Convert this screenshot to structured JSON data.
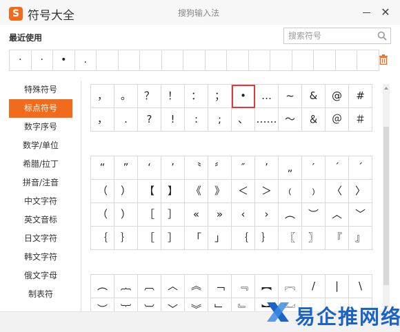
{
  "window": {
    "logo_glyph": "S",
    "title": "符号大全",
    "ime_name": "搜狗输入法",
    "close_glyph": "✕"
  },
  "recent": {
    "label": "最近使用",
    "items": [
      "·",
      "·",
      "•",
      ".",
      "",
      "",
      "",
      "",
      "",
      "",
      "",
      "",
      "",
      "",
      "",
      "",
      ""
    ]
  },
  "search": {
    "placeholder": "搜索符号"
  },
  "categories": [
    "特殊符号",
    "标点符号",
    "数字序号",
    "数学/单位",
    "希腊/拉丁",
    "拼音/注音",
    "中文字符",
    "英文音标",
    "日文字符",
    "韩文字符",
    "俄文字母",
    "制表符"
  ],
  "active_category": 1,
  "selected_symbol": "•",
  "grids": [
    {
      "rows": [
        [
          "，",
          "。",
          "？",
          "！",
          "：",
          "；",
          "•",
          "…",
          "~",
          "&",
          "@",
          "#"
        ],
        [
          "，",
          ".",
          "?",
          "!",
          ":",
          ";",
          "、",
          "……",
          "～",
          "＆",
          "＠",
          "＃"
        ]
      ]
    },
    {
      "rows": [
        [
          "“",
          "”",
          "‘",
          "’",
          "〝",
          "〞",
          "″",
          "’",
          "„",
          "′",
          "ˊ",
          "ˊ"
        ],
        [
          "（",
          "）",
          "【",
          "】",
          "《",
          "》",
          "＜",
          "＞",
          "﹙",
          "﹚",
          "〈",
          "〉"
        ],
        [
          "（",
          "）",
          "［",
          "］",
          "«",
          "»",
          "‹",
          "›",
          "︵",
          "︶",
          "︿",
          "﹀"
        ],
        [
          "｛",
          "｝",
          "［",
          "］",
          "「",
          "」",
          "｛",
          "｝",
          "〖",
          "〗",
          "『",
          "』"
        ]
      ]
    },
    {
      "rows": [
        [
          "︵",
          "︷",
          "︹",
          "︿",
          "︽",
          "﹁",
          "﹃",
          "︻",
          "︗",
          "/",
          "|",
          "\\"
        ],
        [
          "︶",
          "︸",
          "︺",
          "﹀",
          "︾",
          "﹂",
          "﹄",
          "︼",
          "︘",
          "",
          "",
          ""
        ]
      ]
    }
  ],
  "watermark": {
    "text": "易企推网络"
  },
  "colors": {
    "accent": "#f26a1b",
    "selection": "#e03a3a",
    "watermark": "#1b63c8"
  }
}
